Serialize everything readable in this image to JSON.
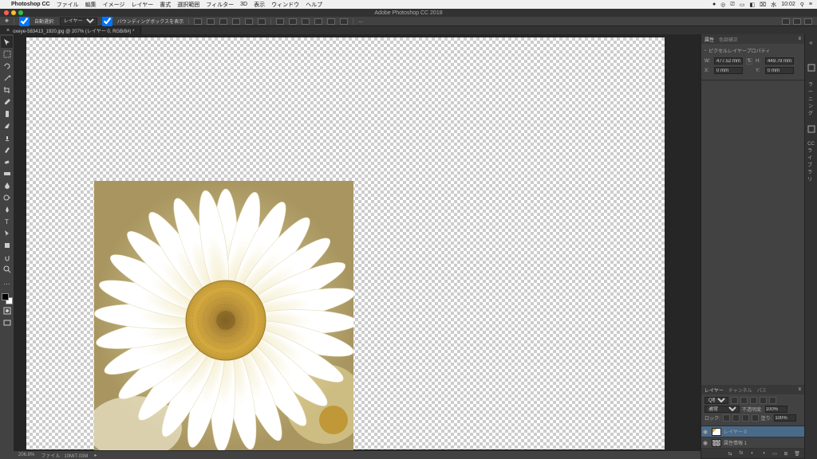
{
  "menubar": {
    "apple": "",
    "app": "Photoshop CC",
    "items": [
      "ファイル",
      "編集",
      "イメージ",
      "レイヤー",
      "書式",
      "選択範囲",
      "フィルター",
      "3D",
      "表示",
      "ウィンドウ",
      "ヘルプ"
    ],
    "right_icons": [
      "●",
      "◎",
      "⎚",
      "▭",
      "◧"
    ],
    "battery": "⌧",
    "day": "水",
    "time": "10:02",
    "search": "⚲",
    "menu": "≡"
  },
  "window": {
    "title": "Adobe Photoshop CC 2018"
  },
  "options": {
    "tool_icon": "✥",
    "auto_select_label": "自動選択:",
    "auto_select_value": "レイヤー",
    "bounding_label": "バウンディングボックスを表示",
    "checkbox_checked": true
  },
  "document": {
    "tab_name": "oxeye-583413_1920.jpg @ 207% (レイヤー 0, RGB/8#) *"
  },
  "status": {
    "zoom": "206.8%",
    "info": "ファイル : 10M/7.03M"
  },
  "properties": {
    "panel_tab_1": "属性",
    "panel_tab_2": "色調補正",
    "subtitle": "ピクセルレイヤープロパティ",
    "w_label": "W:",
    "w_value": "477.52 mm",
    "h_label": "H:",
    "h_value": "449.79 mm",
    "x_label": "X:",
    "x_value": "0 mm",
    "y_label": "Y:",
    "y_value": "0 mm"
  },
  "right_tabs": {
    "learning": "ラーニング",
    "libraries": "CC ライブラリ"
  },
  "layers": {
    "tabs": [
      "レイヤー",
      "チャンネル",
      "パス"
    ],
    "blend_mode": "通常",
    "opacity_label": "不透明度:",
    "opacity": "100%",
    "lock_label": "ロック:",
    "fill_label": "塗り:",
    "fill": "100%",
    "items": [
      {
        "name": "レイヤー 0",
        "visible": true,
        "selected": true
      },
      {
        "name": "属性情報 1",
        "visible": true,
        "selected": false
      }
    ]
  }
}
